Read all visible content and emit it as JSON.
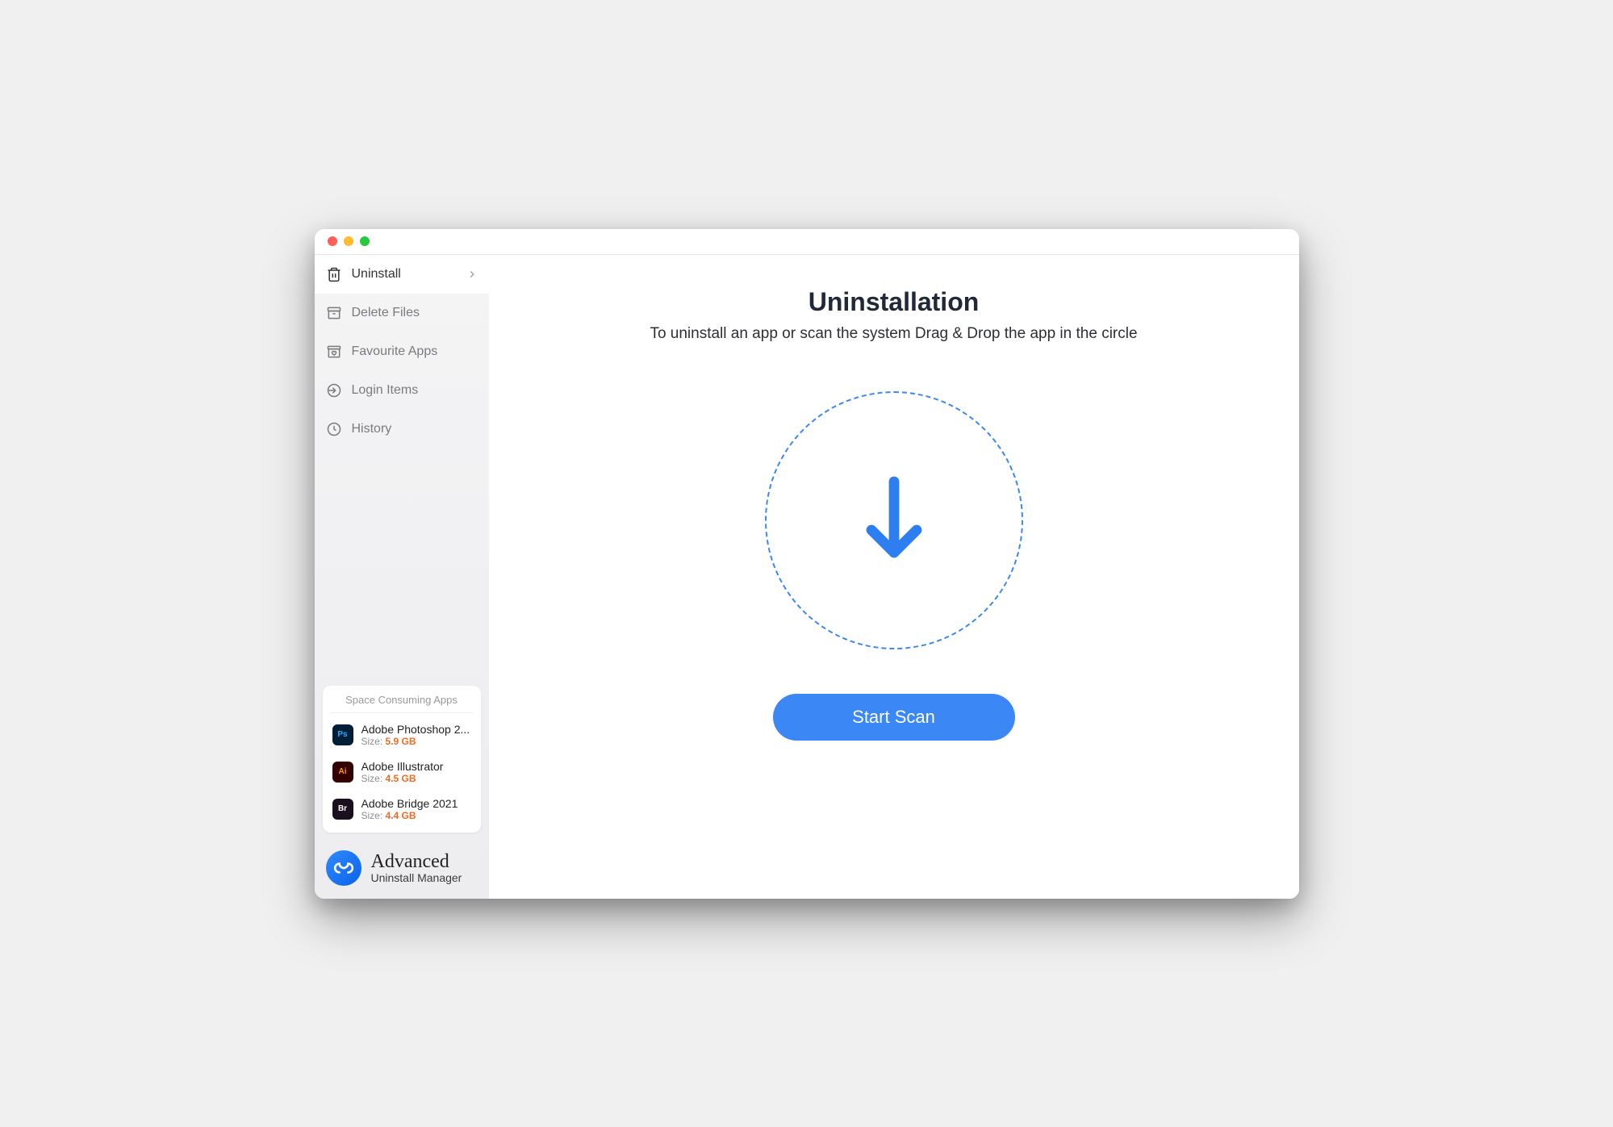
{
  "sidebar": {
    "items": [
      {
        "label": "Uninstall",
        "active": true
      },
      {
        "label": "Delete Files",
        "active": false
      },
      {
        "label": "Favourite Apps",
        "active": false
      },
      {
        "label": "Login Items",
        "active": false
      },
      {
        "label": "History",
        "active": false
      }
    ],
    "space_card": {
      "title": "Space Consuming Apps",
      "size_label": "Size:",
      "apps": [
        {
          "name": "Adobe Photoshop 2...",
          "size": "5.9 GB",
          "icon": "Ps",
          "iconClass": "icon-ps"
        },
        {
          "name": "Adobe Illustrator",
          "size": "4.5 GB",
          "icon": "Ai",
          "iconClass": "icon-ai"
        },
        {
          "name": "Adobe Bridge 2021",
          "size": "4.4 GB",
          "icon": "Br",
          "iconClass": "icon-br"
        }
      ]
    },
    "brand": {
      "line1": "Advanced",
      "line2": "Uninstall Manager"
    }
  },
  "main": {
    "title": "Uninstallation",
    "subtitle": "To uninstall an app or scan the system Drag & Drop the app in the circle",
    "scan_button": "Start Scan"
  }
}
